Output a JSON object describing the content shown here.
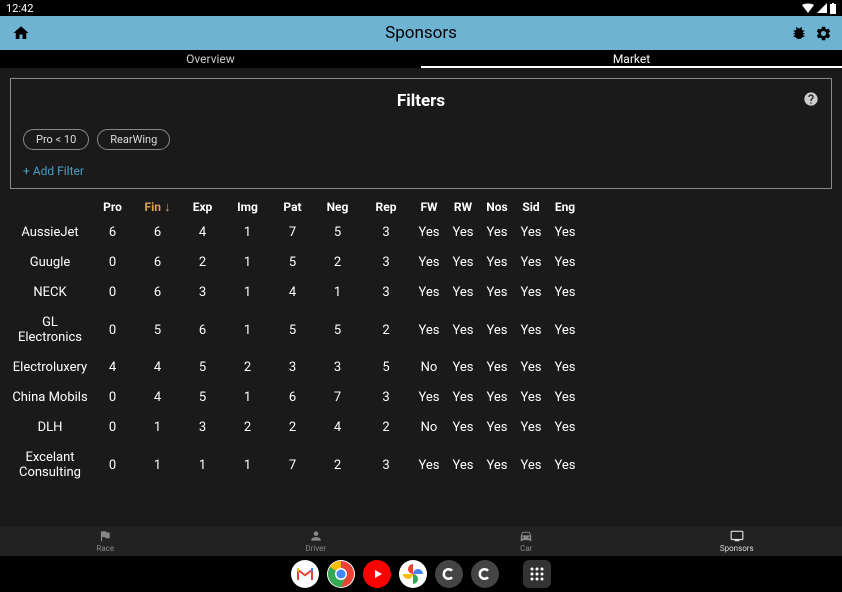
{
  "status": {
    "time": "12:42"
  },
  "appbar": {
    "title": "Sponsors"
  },
  "tabs": {
    "overview": "Overview",
    "market": "Market"
  },
  "filters": {
    "title": "Filters",
    "chips": [
      "Pro < 10",
      "RearWing"
    ],
    "add": "+ Add Filter"
  },
  "columns": [
    "Pro",
    "Fin",
    "Exp",
    "Img",
    "Pat",
    "Neg",
    "Rep",
    "FW",
    "RW",
    "Nos",
    "Sid",
    "Eng"
  ],
  "sort_col": 1,
  "rows": [
    {
      "name": "AussieJet",
      "v": [
        "6",
        "6",
        "4",
        "1",
        "7",
        "5",
        "3",
        "Yes",
        "Yes",
        "Yes",
        "Yes",
        "Yes"
      ]
    },
    {
      "name": "Guugle",
      "v": [
        "0",
        "6",
        "2",
        "1",
        "5",
        "2",
        "3",
        "Yes",
        "Yes",
        "Yes",
        "Yes",
        "Yes"
      ]
    },
    {
      "name": "NECK",
      "v": [
        "0",
        "6",
        "3",
        "1",
        "4",
        "1",
        "3",
        "Yes",
        "Yes",
        "Yes",
        "Yes",
        "Yes"
      ]
    },
    {
      "name": "GL Electronics",
      "v": [
        "0",
        "5",
        "6",
        "1",
        "5",
        "5",
        "2",
        "Yes",
        "Yes",
        "Yes",
        "Yes",
        "Yes"
      ]
    },
    {
      "name": "Electroluxery",
      "v": [
        "4",
        "4",
        "5",
        "2",
        "3",
        "3",
        "5",
        "No",
        "Yes",
        "Yes",
        "Yes",
        "Yes"
      ]
    },
    {
      "name": "China Mobils",
      "v": [
        "0",
        "4",
        "5",
        "1",
        "6",
        "7",
        "3",
        "Yes",
        "Yes",
        "Yes",
        "Yes",
        "Yes"
      ]
    },
    {
      "name": "DLH",
      "v": [
        "0",
        "1",
        "3",
        "2",
        "2",
        "4",
        "2",
        "No",
        "Yes",
        "Yes",
        "Yes",
        "Yes"
      ]
    },
    {
      "name": "Excelant Consulting",
      "v": [
        "0",
        "1",
        "1",
        "1",
        "7",
        "2",
        "3",
        "Yes",
        "Yes",
        "Yes",
        "Yes",
        "Yes"
      ]
    }
  ],
  "nav": {
    "race": "Race",
    "driver": "Driver",
    "car": "Car",
    "sponsors": "Sponsors"
  }
}
